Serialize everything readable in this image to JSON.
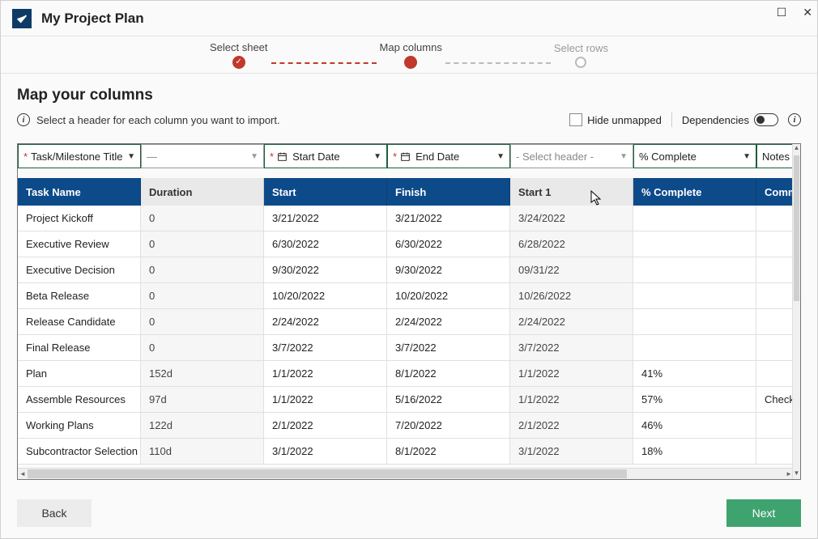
{
  "window": {
    "title": "My Project Plan"
  },
  "wizard": {
    "step1": "Select sheet",
    "step2": "Map columns",
    "step3": "Select rows"
  },
  "section": {
    "title": "Map your columns",
    "instruction": "Select a header for each column you want to import."
  },
  "toolbar": {
    "hide_unmapped": "Hide unmapped",
    "dependencies": "Dependencies"
  },
  "mappers": {
    "c1": "Task/Milestone Title",
    "c2": "—",
    "c3": "Start Date",
    "c4": "End Date",
    "c5": "- Select header -",
    "c6": "% Complete",
    "c7": "Notes"
  },
  "headers": {
    "c1": "Task Name",
    "c2": "Duration",
    "c3": "Start",
    "c4": "Finish",
    "c5": "Start 1",
    "c6": "% Complete",
    "c7": "Comm"
  },
  "rows": [
    {
      "c1": "Project Kickoff",
      "c2": "0",
      "c3": "3/21/2022",
      "c4": "3/21/2022",
      "c5": "3/24/2022",
      "c6": "",
      "c7": ""
    },
    {
      "c1": "Executive Review",
      "c2": "0",
      "c3": "6/30/2022",
      "c4": "6/30/2022",
      "c5": "6/28/2022",
      "c6": "",
      "c7": ""
    },
    {
      "c1": "Executive Decision",
      "c2": "0",
      "c3": "9/30/2022",
      "c4": "9/30/2022",
      "c5": "09/31/22",
      "c6": "",
      "c7": ""
    },
    {
      "c1": "Beta Release",
      "c2": "0",
      "c3": "10/20/2022",
      "c4": "10/20/2022",
      "c5": "10/26/2022",
      "c6": "",
      "c7": ""
    },
    {
      "c1": "Release Candidate",
      "c2": "0",
      "c3": "2/24/2022",
      "c4": "2/24/2022",
      "c5": "2/24/2022",
      "c6": "",
      "c7": ""
    },
    {
      "c1": "Final Release",
      "c2": "0",
      "c3": "3/7/2022",
      "c4": "3/7/2022",
      "c5": "3/7/2022",
      "c6": "",
      "c7": ""
    },
    {
      "c1": "Plan",
      "c2": "152d",
      "c3": "1/1/2022",
      "c4": "8/1/2022",
      "c5": "1/1/2022",
      "c6": "41%",
      "c7": ""
    },
    {
      "c1": "Assemble Resources",
      "c2": "97d",
      "c3": "1/1/2022",
      "c4": "5/16/2022",
      "c5": "1/1/2022",
      "c6": "57%",
      "c7": "Check"
    },
    {
      "c1": "Working Plans",
      "c2": "122d",
      "c3": "2/1/2022",
      "c4": "7/20/2022",
      "c5": "2/1/2022",
      "c6": "46%",
      "c7": ""
    },
    {
      "c1": "Subcontractor Selection",
      "c2": "110d",
      "c3": "3/1/2022",
      "c4": "8/1/2022",
      "c5": "3/1/2022",
      "c6": "18%",
      "c7": ""
    }
  ],
  "footer": {
    "back": "Back",
    "next": "Next"
  }
}
